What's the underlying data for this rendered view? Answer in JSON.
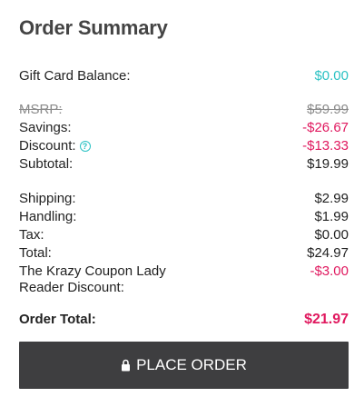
{
  "title": "Order Summary",
  "gift_card": {
    "label": "Gift Card Balance:",
    "value": "$0.00"
  },
  "pricing": {
    "msrp": {
      "label": "MSRP:",
      "value": "$59.99"
    },
    "savings": {
      "label": "Savings:",
      "value": "-$26.67"
    },
    "discount": {
      "label": "Discount:",
      "value": "-$13.33",
      "help_icon": "?"
    },
    "subtotal": {
      "label": "Subtotal:",
      "value": "$19.99"
    }
  },
  "charges": {
    "shipping": {
      "label": "Shipping:",
      "value": "$2.99"
    },
    "handling": {
      "label": "Handling:",
      "value": "$1.99"
    },
    "tax": {
      "label": "Tax:",
      "value": "$0.00"
    },
    "total": {
      "label": "Total:",
      "value": "$24.97"
    },
    "reader_discount": {
      "label_line1": "The Krazy Coupon Lady",
      "label_line2": "Reader Discount:",
      "value": "-$3.00"
    }
  },
  "order_total": {
    "label": "Order Total:",
    "value": "$21.97"
  },
  "button": {
    "label": "PLACE ORDER",
    "icon": "lock-icon"
  },
  "colors": {
    "accent": "#2cc2c4",
    "negative": "#e0195f",
    "button_bg": "#3e3e40"
  }
}
